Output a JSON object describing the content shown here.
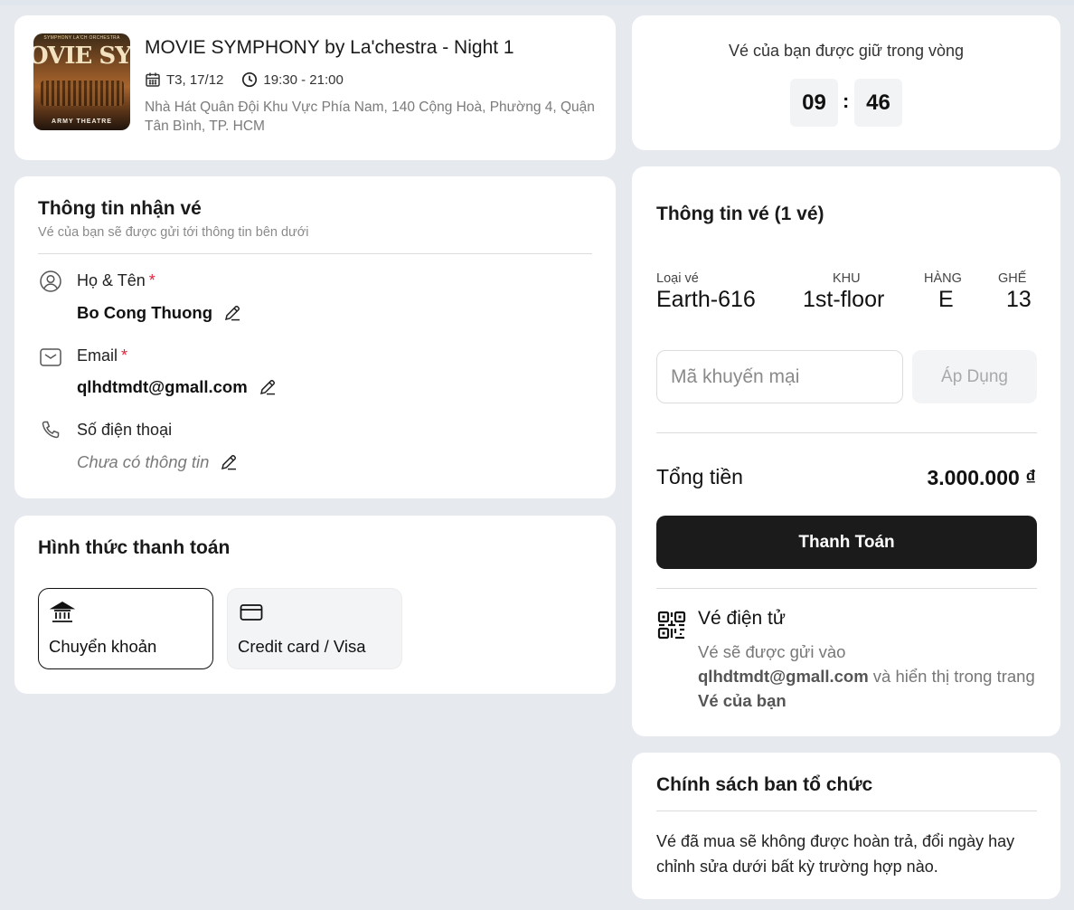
{
  "event": {
    "title": "MOVIE SYMPHONY by La'chestra - Night 1",
    "date": "T3, 17/12",
    "time": "19:30 - 21:00",
    "address": "Nhà Hát Quân Đội Khu Vực Phía Nam, 140 Cộng Hoà, Phường 4, Quận Tân Bình, TP. HCM",
    "poster": {
      "top_text": "SYMPHONY LA'CH ORCHESTRA",
      "big_text": "OVIE SYMPHO",
      "bottom_text": "ARMY THEATRE"
    }
  },
  "timer": {
    "label": "Vé của bạn được giữ trong vòng",
    "minutes": "09",
    "separator": ":",
    "seconds": "46"
  },
  "receiver": {
    "title": "Thông tin nhận vé",
    "subtitle": "Vé của bạn sẽ được gửi tới thông tin bên dưới",
    "required_mark": "*",
    "name_label": "Họ & Tên",
    "name_value": "Bo Cong Thuong",
    "email_label": "Email",
    "email_value": "qlhdtmdt@gmall.com",
    "phone_label": "Số điện thoại",
    "phone_value": "Chưa có thông tin"
  },
  "payment": {
    "title": "Hình thức thanh toán",
    "options": [
      {
        "label": "Chuyển khoản",
        "icon": "bank-icon",
        "selected": true
      },
      {
        "label": "Credit card / Visa",
        "icon": "credit-card-icon",
        "selected": false
      }
    ]
  },
  "ticket": {
    "title": "Thông tin vé (1 vé)",
    "columns": {
      "type": "Loại vé",
      "zone": "KHU",
      "row": "HÀNG",
      "seat": "GHẾ"
    },
    "values": {
      "type": "Earth-616",
      "zone": "1st-floor",
      "row": "E",
      "seat": "13"
    },
    "promo_placeholder": "Mã khuyến mại",
    "apply_label": "Áp Dụng",
    "total_label": "Tổng tiền",
    "total_value": "3.000.000 ₫",
    "pay_label": "Thanh Toán",
    "eticket_title": "Vé điện tử",
    "eticket_desc_prefix": "Vé sẽ được gửi vào",
    "eticket_email": "qlhdtmdt@gmall.com",
    "eticket_desc_middle": "và hiển thị trong trang",
    "eticket_page": "Vé của bạn"
  },
  "policy": {
    "title": "Chính sách ban tổ chức",
    "text": "Vé đã mua sẽ không được hoàn trả, đổi ngày hay chỉnh sửa dưới bất kỳ trường hợp nào."
  }
}
